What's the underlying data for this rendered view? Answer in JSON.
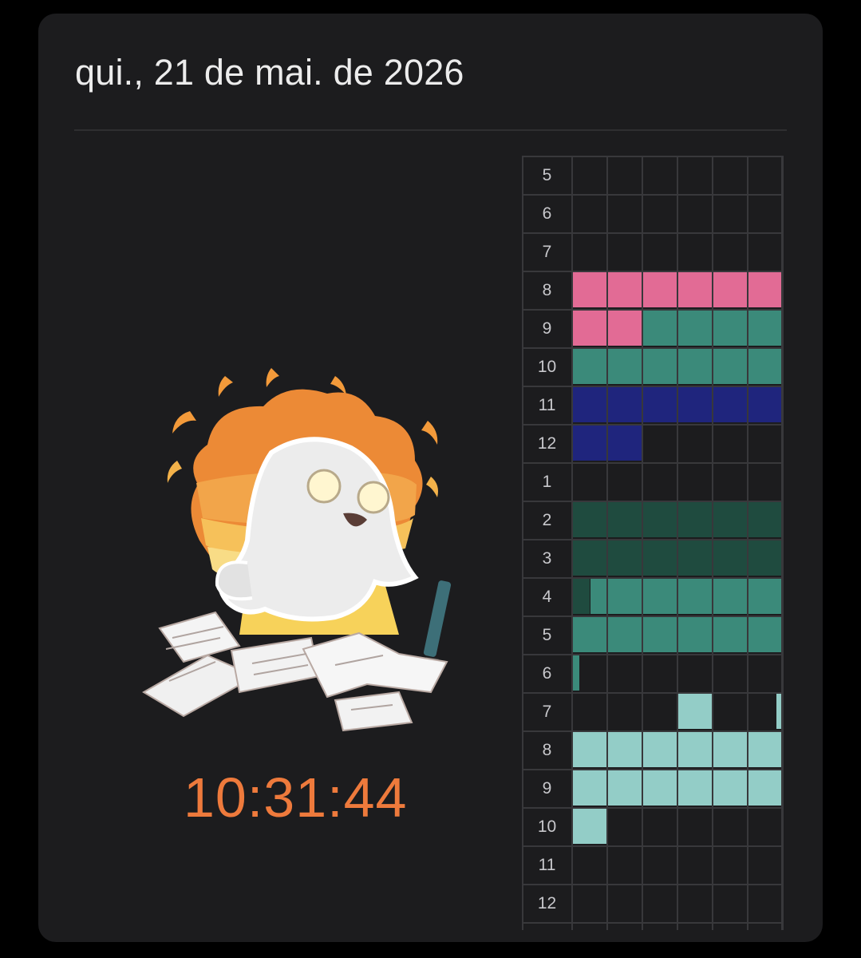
{
  "header": {
    "date": "qui., 21 de mai. de 2026"
  },
  "clock": {
    "time": "10:31:44",
    "color": "#ee7a3c"
  },
  "illustration": {
    "icon": "ghost-studying-icon"
  },
  "schedule": {
    "hours": [
      "5",
      "6",
      "7",
      "8",
      "9",
      "10",
      "11",
      "12",
      "1",
      "2",
      "3",
      "4",
      "5",
      "6",
      "7",
      "8",
      "9",
      "10",
      "11",
      "12"
    ],
    "columns": 6,
    "colors": {
      "pink": "#e26b95",
      "teal": "#3b8a7a",
      "navy": "#1f257d",
      "dark_green": "#1f4b3f",
      "mint": "#93cdc7"
    },
    "blocks": [
      {
        "category": "pink",
        "start": 3.0,
        "end": 4.0
      },
      {
        "category": "pink",
        "start": 4.0,
        "end": 4.3333
      },
      {
        "category": "teal",
        "start": 4.3333,
        "end": 6.0
      },
      {
        "category": "navy",
        "start": 6.0,
        "end": 7.0
      },
      {
        "category": "navy",
        "start": 7.0,
        "end": 7.3333
      },
      {
        "category": "dark_green",
        "start": 9.0,
        "end": 11.0833
      },
      {
        "category": "teal",
        "start": 11.0833,
        "end": 13.0
      },
      {
        "category": "teal",
        "start": 13.0,
        "end": 13.0333
      },
      {
        "category": "mint",
        "start": 14.5,
        "end": 14.6667
      },
      {
        "category": "mint",
        "start": 14.9667,
        "end": 15.0
      },
      {
        "category": "mint",
        "start": 15.0,
        "end": 17.0
      },
      {
        "category": "mint",
        "start": 17.0,
        "end": 17.1667
      }
    ]
  }
}
